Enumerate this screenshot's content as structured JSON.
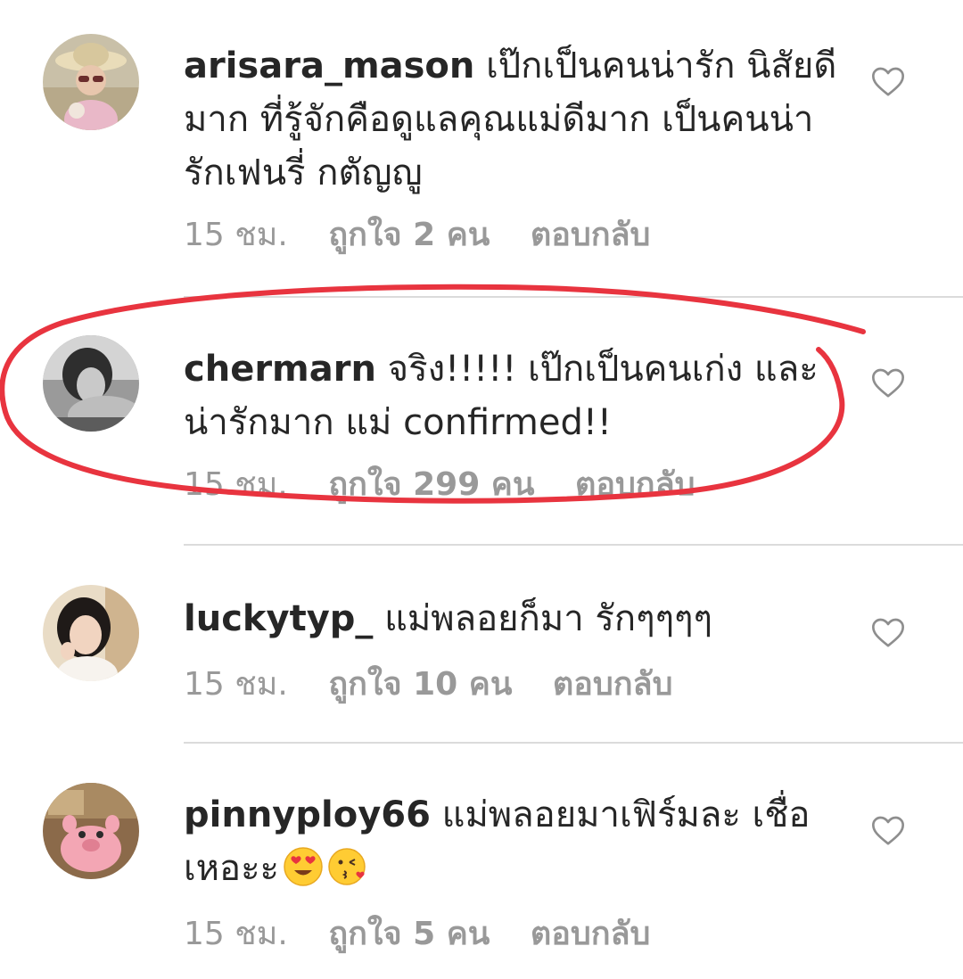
{
  "comments": [
    {
      "username": "arisara_mason",
      "text": "เป๊กเป็นคนน่ารัก นิสัยดีมาก ที่รู้จักคือดูแลคุณแม่ดีมาก เป็นคนน่ารักเฟนรี่ กตัญญู",
      "time": "15 ชม.",
      "likes": "ถูกใจ 2 คน",
      "reply": "ตอบกลับ"
    },
    {
      "username": "chermarn",
      "text": "จริง!!!!! เป๊กเป็นคนเก่ง และ น่ารักมาก แม่ confirmed!!",
      "time": "15 ชม.",
      "likes": "ถูกใจ 299 คน",
      "reply": "ตอบกลับ"
    },
    {
      "username": "luckytyp_",
      "text": "แม่พลอยก็มา รักๆๆๆๆ",
      "time": "15 ชม.",
      "likes": "ถูกใจ 10 คน",
      "reply": "ตอบกลับ"
    },
    {
      "username": "pinnyploy66",
      "text": "แม่พลอยมาเฟิร์มละ เชื่อเหอะะ",
      "emojis": [
        "heart-eyes-emoji",
        "kissing-heart-emoji"
      ],
      "time": "15 ชม.",
      "likes": "ถูกใจ 5 คน",
      "reply": "ตอบกลับ"
    }
  ],
  "icons": {
    "like": "heart-outline-icon"
  },
  "colors": {
    "text": "#262626",
    "meta": "#999999",
    "divider": "#dbdbdb",
    "annotation": "#e8343f"
  }
}
